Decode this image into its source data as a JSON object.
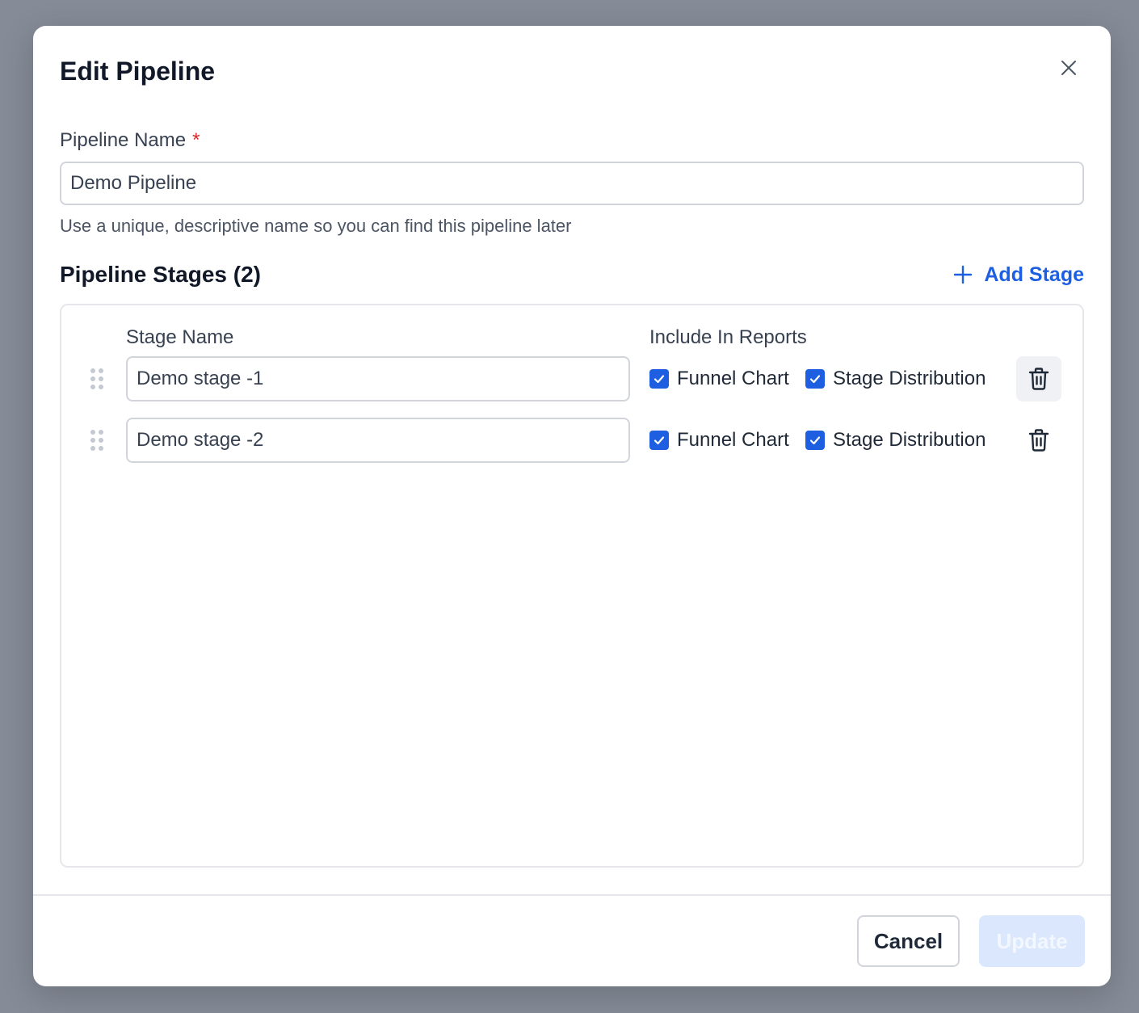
{
  "dialog": {
    "title": "Edit Pipeline"
  },
  "pipeline_name": {
    "label": "Pipeline Name",
    "required_marker": "*",
    "value": "Demo Pipeline",
    "help_text": "Use a unique, descriptive name so you can find this pipeline later"
  },
  "stages_section": {
    "title": "Pipeline Stages (2)",
    "add_stage_label": "Add Stage",
    "column_stage_name": "Stage Name",
    "column_include_reports": "Include In Reports",
    "stages": [
      {
        "name": "Demo stage -1",
        "funnel_chart_label": "Funnel Chart",
        "funnel_chart_checked": true,
        "stage_distribution_label": "Stage Distribution",
        "stage_distribution_checked": true
      },
      {
        "name": "Demo stage -2",
        "funnel_chart_label": "Funnel Chart",
        "funnel_chart_checked": true,
        "stage_distribution_label": "Stage Distribution",
        "stage_distribution_checked": true
      }
    ]
  },
  "footer": {
    "cancel_label": "Cancel",
    "update_label": "Update",
    "update_disabled": true
  },
  "colors": {
    "accent": "#1d5fe0",
    "required": "#dc2626",
    "overlay": "#858b97",
    "disabled_button": "#dbe7fd"
  },
  "icons": {
    "close": "close-icon",
    "add": "plus-icon",
    "drag": "drag-handle-icon",
    "delete": "trash-icon",
    "check": "checkmark-icon"
  }
}
